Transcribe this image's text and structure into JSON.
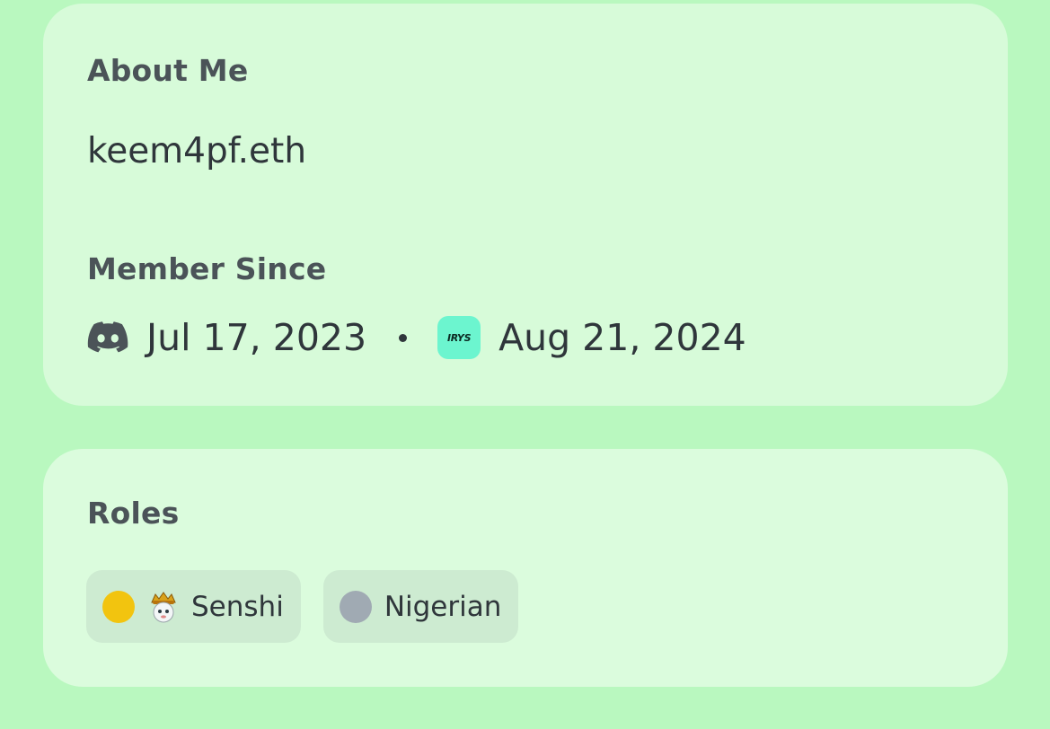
{
  "about": {
    "title": "About Me",
    "text": "keem4pf.eth"
  },
  "member_since": {
    "title": "Member Since",
    "discord_date": "Jul 17, 2023",
    "discord_icon": "discord-icon",
    "separator": "•",
    "server_icon_text": "IRYS",
    "server_date": "Aug 21, 2024"
  },
  "roles": {
    "title": "Roles",
    "items": [
      {
        "label": "Senshi",
        "color": "#f2c40f",
        "emoji_icon": "senshi-emoji-icon"
      },
      {
        "label": "Nigerian",
        "color": "#a0aab3"
      }
    ]
  },
  "colors": {
    "background": "#b9f8bf",
    "card": "#d7fbd9",
    "chip": "#cdebd1",
    "server_accent": "#6cf5cf"
  }
}
